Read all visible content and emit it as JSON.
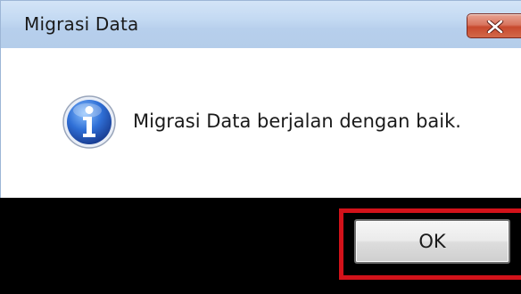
{
  "window": {
    "title": "Migrasi Data",
    "close_icon": "close-icon"
  },
  "dialog": {
    "icon": "info-icon",
    "message": "Migrasi Data berjalan dengan baik."
  },
  "buttons": {
    "ok_label": "OK"
  },
  "colors": {
    "highlight_border": "#d3121a",
    "close_button": "#c84a2e",
    "info_icon": "#2f6fd6"
  }
}
